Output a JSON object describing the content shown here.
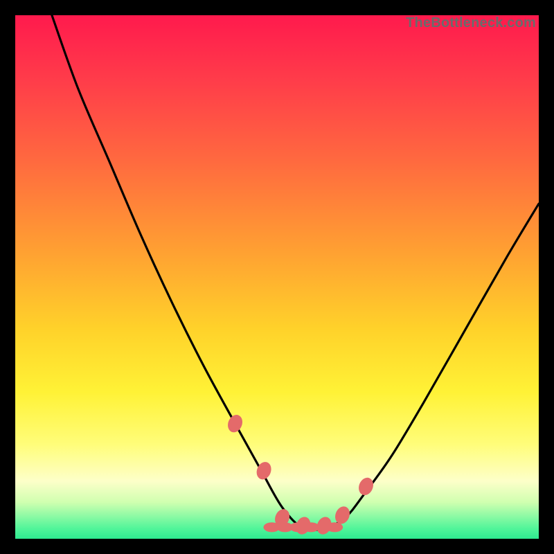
{
  "watermark": "TheBottleneck.com",
  "chart_data": {
    "type": "line",
    "title": "",
    "xlabel": "",
    "ylabel": "",
    "xlim": [
      0,
      100
    ],
    "ylim": [
      0,
      100
    ],
    "grid": false,
    "legend": false,
    "background_gradient_stops": [
      {
        "pos": 0,
        "color": "#ff1a4d"
      },
      {
        "pos": 12,
        "color": "#ff3b4a"
      },
      {
        "pos": 28,
        "color": "#ff6a3f"
      },
      {
        "pos": 45,
        "color": "#ffa032"
      },
      {
        "pos": 60,
        "color": "#ffd22a"
      },
      {
        "pos": 72,
        "color": "#fff236"
      },
      {
        "pos": 82,
        "color": "#fffd7a"
      },
      {
        "pos": 89,
        "color": "#fdffc9"
      },
      {
        "pos": 93,
        "color": "#d0ffb0"
      },
      {
        "pos": 98,
        "color": "#52f59a"
      },
      {
        "pos": 100,
        "color": "#2ee98f"
      }
    ],
    "series": [
      {
        "name": "bottleneck-curve",
        "color": "#000000",
        "x": [
          7,
          12,
          18,
          24,
          30,
          36,
          42,
          47,
          51,
          55,
          59,
          63,
          67,
          72,
          78,
          86,
          94,
          100
        ],
        "values": [
          100,
          86,
          72,
          58,
          45,
          33,
          22,
          13,
          6,
          2,
          2,
          4,
          9,
          16,
          26,
          40,
          54,
          64
        ]
      }
    ],
    "markers": {
      "name": "optimal-range-markers",
      "color": "#e46a6a",
      "shape": "rounded-lozenge",
      "x": [
        42.0,
        47.5,
        51.0,
        55.0,
        59.0,
        62.5,
        67.0
      ],
      "values": [
        22.0,
        13.0,
        4.0,
        2.5,
        2.5,
        4.5,
        10.0
      ]
    }
  }
}
